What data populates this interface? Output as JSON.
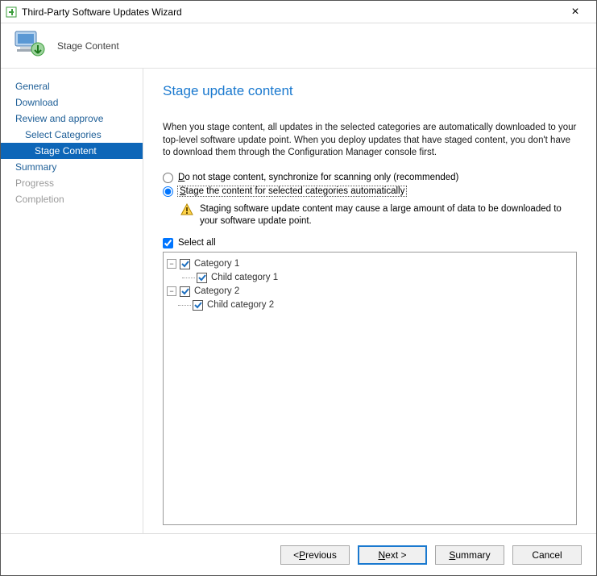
{
  "window": {
    "title": "Third-Party Software Updates Wizard"
  },
  "header": {
    "page_name": "Stage Content"
  },
  "sidebar": {
    "items": [
      {
        "label": "General"
      },
      {
        "label": "Download"
      },
      {
        "label": "Review and approve"
      },
      {
        "label": "Select Categories"
      },
      {
        "label": "Stage Content"
      },
      {
        "label": "Summary"
      },
      {
        "label": "Progress"
      },
      {
        "label": "Completion"
      }
    ]
  },
  "content": {
    "title": "Stage update content",
    "description": "When you stage content, all updates in the selected categories are automatically downloaded to your top-level software update point. When you deploy updates that have staged content, you don't have to download them through the Configuration Manager console first.",
    "option1_prefix": "D",
    "option1_rest": "o not stage content, synchronize for scanning only (recommended)",
    "option2_prefix": "S",
    "option2_rest": "tage the content for selected categories automatically",
    "warning": "Staging software update content may cause a large amount of data to be downloaded to your software update point.",
    "selectall_prefix": "S",
    "selectall_rest": "elect all",
    "tree": [
      {
        "label": "Category 1"
      },
      {
        "label": "Child category 1"
      },
      {
        "label": "Category 2"
      },
      {
        "label": "Child category 2"
      }
    ]
  },
  "footer": {
    "prev_u": "P",
    "prev_rest": "revious",
    "prev_lead": "< ",
    "next_u": "N",
    "next_rest": "ext >",
    "summary_u": "S",
    "summary_rest": "ummary",
    "cancel": "Cancel"
  }
}
